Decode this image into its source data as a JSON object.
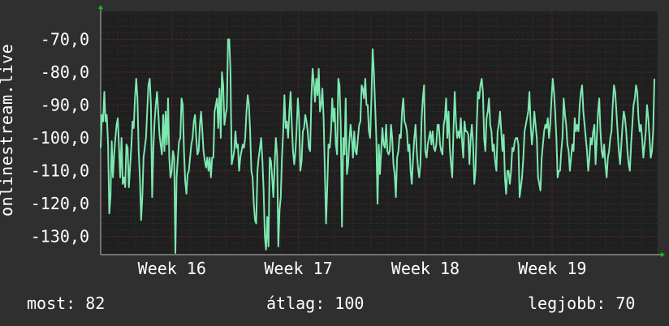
{
  "chart_data": {
    "type": "line",
    "ylabel": "onlinestream.live",
    "ylim": [
      -135.5,
      -61.5
    ],
    "yticks": [
      -70,
      -80,
      -90,
      -100,
      -110,
      -120,
      -130
    ],
    "ytick_labels": [
      "-70,0",
      "-80,0",
      "-90,0",
      "-100,0",
      "-110,0",
      "-120,0",
      "-130,0"
    ],
    "xlim": [
      0,
      1
    ],
    "xticks": [
      0.128,
      0.355,
      0.583,
      0.811
    ],
    "xtick_labels": [
      "Week 16",
      "Week 17",
      "Week 18",
      "Week 19"
    ],
    "grid": true,
    "colors": {
      "background": "#2f2f2f",
      "plot": "#1f1f1f",
      "grid": "#5a2020",
      "line": "#7de8b0",
      "axis": "#ffffff",
      "arrow": "#00cc00"
    },
    "series": [
      {
        "values": [
          -103,
          -93,
          -95,
          -86,
          -95,
          -93,
          -102,
          -123,
          -118,
          -101,
          -112,
          -105,
          -100,
          -96,
          -94,
          -103,
          -112,
          -100,
          -114,
          -112,
          -115,
          -102,
          -103,
          -115,
          -109,
          -103,
          -95,
          -97,
          -88,
          -82,
          -88,
          -104,
          -112,
          -125,
          -118,
          -106,
          -103,
          -100,
          -92,
          -84,
          -82,
          -90,
          -118,
          -103,
          -95,
          -90,
          -86,
          -92,
          -99,
          -102,
          -105,
          -93,
          -104,
          -92,
          -102,
          -88,
          -106,
          -112,
          -110,
          -104,
          -106,
          -135,
          -112,
          -106,
          -101,
          -100,
          -88,
          -90,
          -104,
          -113,
          -117,
          -111,
          -110,
          -106,
          -102,
          -100,
          -95,
          -93,
          -100,
          -105,
          -104,
          -96,
          -92,
          -98,
          -104,
          -107,
          -109,
          -106,
          -110,
          -106,
          -112,
          -106,
          -106,
          -92,
          -90,
          -88,
          -97,
          -85,
          -100,
          -80,
          -84,
          -96,
          -93,
          -91,
          -70,
          -70,
          -80,
          -108,
          -106,
          -104,
          -98,
          -103,
          -102,
          -110,
          -106,
          -104,
          -102,
          -103,
          -100,
          -92,
          -87,
          -90,
          -98,
          -110,
          -112,
          -120,
          -125,
          -126,
          -110,
          -106,
          -103,
          -100,
          -107,
          -116,
          -130,
          -134,
          -124,
          -133,
          -106,
          -107,
          -112,
          -118,
          -108,
          -100,
          -105,
          -133,
          -122,
          -118,
          -106,
          -98,
          -87,
          -97,
          -95,
          -100,
          -92,
          -86,
          -96,
          -104,
          -108,
          -104,
          -97,
          -88,
          -94,
          -110,
          -107,
          -98,
          -97,
          -93,
          -95,
          -98,
          -103,
          -104,
          -88,
          -79,
          -83,
          -89,
          -82,
          -87,
          -79,
          -92,
          -90,
          -85,
          -94,
          -110,
          -126,
          -115,
          -102,
          -103,
          -98,
          -88,
          -95,
          -91,
          -102,
          -105,
          -82,
          -84,
          -96,
          -127,
          -100,
          -105,
          -88,
          -111,
          -108,
          -101,
          -96,
          -100,
          -106,
          -98,
          -104,
          -105,
          -100,
          -96,
          -95,
          -84,
          -85,
          -88,
          -82,
          -90,
          -90,
          -98,
          -100,
          -88,
          -73,
          -80,
          -90,
          -100,
          -120,
          -102,
          -111,
          -104,
          -97,
          -102,
          -103,
          -96,
          -104,
          -105,
          -104,
          -96,
          -100,
          -108,
          -111,
          -118,
          -106,
          -104,
          -99,
          -100,
          -92,
          -88,
          -95,
          -96,
          -98,
          -104,
          -102,
          -110,
          -114,
          -106,
          -100,
          -96,
          -104,
          -109,
          -112,
          -108,
          -94,
          -88,
          -84,
          -104,
          -106,
          -102,
          -100,
          -98,
          -102,
          -98,
          -103,
          -104,
          -102,
          -96,
          -96,
          -102,
          -104,
          -105,
          -96,
          -94,
          -88,
          -100,
          -92,
          -103,
          -108,
          -112,
          -98,
          -86,
          -95,
          -100,
          -98,
          -100,
          -94,
          -101,
          -106,
          -95,
          -98,
          -98,
          -99,
          -108,
          -100,
          -96,
          -102,
          -114,
          -110,
          -96,
          -86,
          -88,
          -84,
          -82,
          -86,
          -100,
          -104,
          -94,
          -92,
          -88,
          -96,
          -98,
          -104,
          -102,
          -107,
          -110,
          -98,
          -96,
          -92,
          -98,
          -104,
          -99,
          -112,
          -117,
          -110,
          -110,
          -114,
          -110,
          -103,
          -104,
          -101,
          -100,
          -100,
          -102,
          -118,
          -115,
          -112,
          -106,
          -98,
          -96,
          -94,
          -92,
          -86,
          -96,
          -102,
          -98,
          -92,
          -96,
          -100,
          -112,
          -114,
          -116,
          -106,
          -102,
          -98,
          -96,
          -97,
          -94,
          -100,
          -96,
          -88,
          -82,
          -86,
          -92,
          -100,
          -112,
          -110,
          -110,
          -104,
          -100,
          -88,
          -93,
          -96,
          -102,
          -104,
          -110,
          -106,
          -102,
          -104,
          -94,
          -98,
          -96,
          -98,
          -90,
          -86,
          -84,
          -92,
          -96,
          -100,
          -104,
          -110,
          -106,
          -100,
          -102,
          -98,
          -96,
          -108,
          -100,
          -92,
          -88,
          -98,
          -104,
          -106,
          -102,
          -108,
          -112,
          -106,
          -104,
          -100,
          -98,
          -90,
          -84,
          -86,
          -92,
          -98,
          -104,
          -108,
          -102,
          -96,
          -92,
          -94,
          -98,
          -104,
          -108,
          -110,
          -102,
          -96,
          -90,
          -88,
          -84,
          -86,
          -94,
          -98,
          -96,
          -100,
          -106,
          -102,
          -98,
          -90,
          -94,
          -100,
          -106,
          -104,
          -98,
          -82
        ],
        "color": "#7de8b0"
      }
    ]
  },
  "stats": [
    {
      "label": "most:",
      "value": "82"
    },
    {
      "label": "átlag:",
      "value": "100"
    },
    {
      "label": "legjobb:",
      "value": "70"
    }
  ]
}
